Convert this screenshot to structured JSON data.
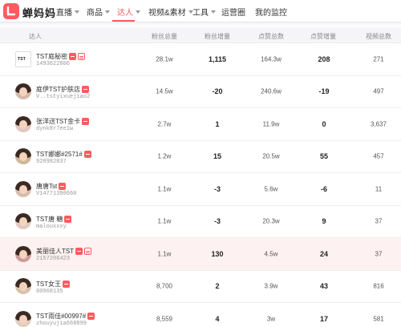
{
  "app": {
    "brand": "蝉妈妈"
  },
  "nav": {
    "items": [
      {
        "label": "直播",
        "has_dropdown": true,
        "active": false
      },
      {
        "label": "商品",
        "has_dropdown": true,
        "active": false
      },
      {
        "label": "达人",
        "has_dropdown": true,
        "active": true
      },
      {
        "label": "视频&素材",
        "has_dropdown": true,
        "active": false
      },
      {
        "label": "工具",
        "has_dropdown": true,
        "active": false
      },
      {
        "label": "运营圈",
        "has_dropdown": false,
        "active": false
      },
      {
        "label": "我的监控",
        "has_dropdown": false,
        "active": false
      }
    ]
  },
  "table": {
    "headers": [
      "达人",
      "粉丝总量",
      "粉丝增量",
      "点赞总数",
      "点赞增量",
      "视频总数"
    ],
    "rows": [
      {
        "nickname": "TST庭秘密",
        "uid": "1493622806",
        "badges": [
          "red",
          "shop"
        ],
        "fans_total": "28.1w",
        "fans_inc": "1,115",
        "likes_total": "164.3w",
        "likes_inc": "208",
        "videos": "271",
        "avatar": "logo-icon",
        "highlight": false
      },
      {
        "nickname": "庭伊TST护肤店",
        "uid": "V..tstyixuejiao2",
        "badges": [
          "red"
        ],
        "fans_total": "14.5w",
        "fans_inc": "-20",
        "likes_total": "240.6w",
        "likes_inc": "-19",
        "videos": "497",
        "avatar": "person-icon",
        "highlight": false
      },
      {
        "nickname": "张洋送TST金卡",
        "uid": "dynk8r7ee1w",
        "badges": [
          "red"
        ],
        "fans_total": "2.7w",
        "fans_inc": "1",
        "likes_total": "11.9w",
        "likes_inc": "0",
        "videos": "3,637",
        "avatar": "person-icon",
        "highlight": false
      },
      {
        "nickname": "TST娜娜#2571#",
        "uid": "928982837",
        "badges": [
          "red"
        ],
        "fans_total": "1.2w",
        "fans_inc": "15",
        "likes_total": "20.5w",
        "likes_inc": "55",
        "videos": "457",
        "avatar": "person-icon",
        "highlight": false
      },
      {
        "nickname": "唐唐Tst",
        "uid": "V14771390660",
        "badges": [
          "red"
        ],
        "fans_total": "1.1w",
        "fans_inc": "-3",
        "likes_total": "5.6w",
        "likes_inc": "-6",
        "videos": "11",
        "avatar": "person-icon",
        "highlight": false
      },
      {
        "nickname": "TST唐 糖",
        "uid": "malouxxxy",
        "badges": [
          "red"
        ],
        "fans_total": "1.1w",
        "fans_inc": "-3",
        "likes_total": "20.3w",
        "likes_inc": "9",
        "videos": "37",
        "avatar": "person-icon",
        "highlight": false
      },
      {
        "nickname": "美丽佳人TST",
        "uid": "2157206423",
        "badges": [
          "red",
          "shop"
        ],
        "fans_total": "1.1w",
        "fans_inc": "130",
        "likes_total": "4.5w",
        "likes_inc": "24",
        "videos": "37",
        "avatar": "person-icon",
        "highlight": true
      },
      {
        "nickname": "TST女王",
        "uid": "80968135",
        "badges": [
          "red"
        ],
        "fans_total": "8,700",
        "fans_inc": "2",
        "likes_total": "3.9w",
        "likes_inc": "43",
        "videos": "816",
        "avatar": "person-icon",
        "highlight": false
      },
      {
        "nickname": "TST雨佳#00997#",
        "uid": "zhouyujia668899",
        "badges": [
          "red"
        ],
        "fans_total": "8,559",
        "fans_inc": "4",
        "likes_total": "3w",
        "likes_inc": "17",
        "videos": "581",
        "avatar": "person-icon",
        "highlight": false
      }
    ]
  },
  "colors": {
    "accent": "#ff5a5f",
    "header_bg": "#f5f5f7",
    "highlight_row": "#fdf1f1"
  }
}
